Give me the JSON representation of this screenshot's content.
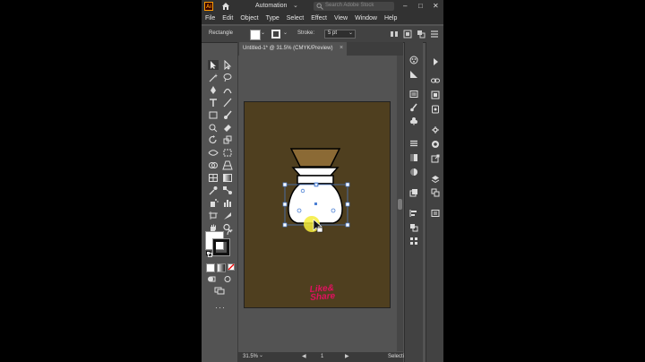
{
  "app": {
    "logo": "Ai",
    "workspace": "Automation",
    "search_placeholder": "Search Adobe Stock",
    "window_controls": [
      "–",
      "□",
      "✕"
    ]
  },
  "menu": [
    "File",
    "Edit",
    "Object",
    "Type",
    "Select",
    "Effect",
    "View",
    "Window",
    "Help"
  ],
  "control_bar": {
    "selection": "Rectangle",
    "stroke_label": "Stroke:",
    "stroke_value": "5 pt"
  },
  "document": {
    "tab_title": "Untitled-1* @ 31.5% (CMYK/Preview)",
    "close": "×"
  },
  "status": {
    "zoom": "31.5%",
    "page": "1",
    "tool": "Selecti"
  },
  "artwork": {
    "artboard_color": "#4f3f1f",
    "filter_color": "#8b6a35",
    "vessel_color": "#ffffff",
    "watermark_line1": "Like&",
    "watermark_line2": "Share",
    "watermark_color": "#e0115f"
  },
  "colors": {
    "fill": "#ffffff",
    "stroke": "#000000"
  }
}
